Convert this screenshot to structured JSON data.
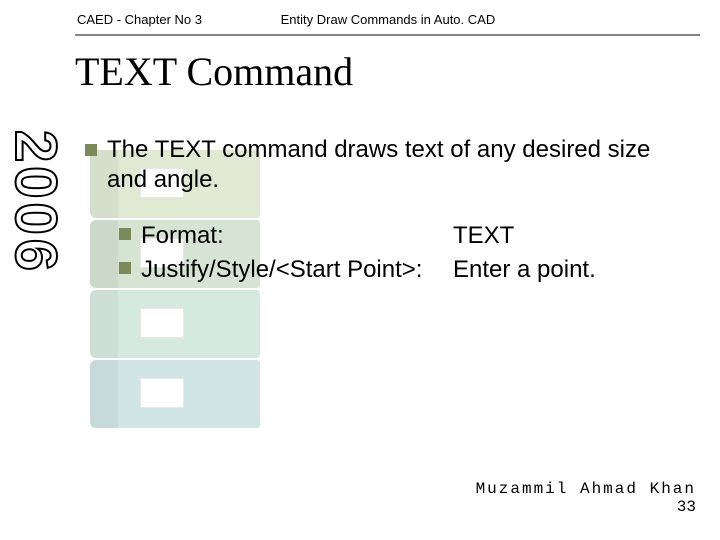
{
  "header": {
    "left": "CAED - Chapter No 3",
    "right": "Entity Draw Commands in Auto. CAD"
  },
  "title": "TEXT Command",
  "side_year": "2006",
  "body": {
    "main_bullet": "The TEXT command draws text of any desired size and angle.",
    "sub1_label": "Format:",
    "sub1_value": "TEXT",
    "sub2_label": "Justify/Style/<Start Point>:",
    "sub2_value": "Enter a point."
  },
  "footer": {
    "author": "Muzammil Ahmad Khan",
    "page": "33"
  }
}
